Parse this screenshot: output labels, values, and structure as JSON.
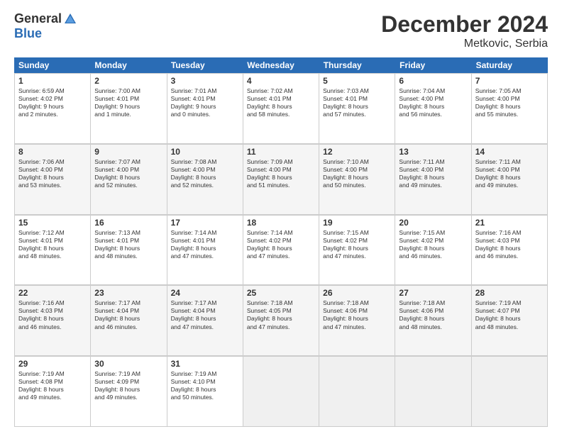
{
  "logo": {
    "general": "General",
    "blue": "Blue"
  },
  "title": "December 2024",
  "location": "Metkovic, Serbia",
  "header_days": [
    "Sunday",
    "Monday",
    "Tuesday",
    "Wednesday",
    "Thursday",
    "Friday",
    "Saturday"
  ],
  "weeks": [
    [
      {
        "day": "1",
        "lines": [
          "Sunrise: 6:59 AM",
          "Sunset: 4:02 PM",
          "Daylight: 9 hours",
          "and 2 minutes."
        ]
      },
      {
        "day": "2",
        "lines": [
          "Sunrise: 7:00 AM",
          "Sunset: 4:01 PM",
          "Daylight: 9 hours",
          "and 1 minute."
        ]
      },
      {
        "day": "3",
        "lines": [
          "Sunrise: 7:01 AM",
          "Sunset: 4:01 PM",
          "Daylight: 9 hours",
          "and 0 minutes."
        ]
      },
      {
        "day": "4",
        "lines": [
          "Sunrise: 7:02 AM",
          "Sunset: 4:01 PM",
          "Daylight: 8 hours",
          "and 58 minutes."
        ]
      },
      {
        "day": "5",
        "lines": [
          "Sunrise: 7:03 AM",
          "Sunset: 4:01 PM",
          "Daylight: 8 hours",
          "and 57 minutes."
        ]
      },
      {
        "day": "6",
        "lines": [
          "Sunrise: 7:04 AM",
          "Sunset: 4:00 PM",
          "Daylight: 8 hours",
          "and 56 minutes."
        ]
      },
      {
        "day": "7",
        "lines": [
          "Sunrise: 7:05 AM",
          "Sunset: 4:00 PM",
          "Daylight: 8 hours",
          "and 55 minutes."
        ]
      }
    ],
    [
      {
        "day": "8",
        "lines": [
          "Sunrise: 7:06 AM",
          "Sunset: 4:00 PM",
          "Daylight: 8 hours",
          "and 53 minutes."
        ]
      },
      {
        "day": "9",
        "lines": [
          "Sunrise: 7:07 AM",
          "Sunset: 4:00 PM",
          "Daylight: 8 hours",
          "and 52 minutes."
        ]
      },
      {
        "day": "10",
        "lines": [
          "Sunrise: 7:08 AM",
          "Sunset: 4:00 PM",
          "Daylight: 8 hours",
          "and 52 minutes."
        ]
      },
      {
        "day": "11",
        "lines": [
          "Sunrise: 7:09 AM",
          "Sunset: 4:00 PM",
          "Daylight: 8 hours",
          "and 51 minutes."
        ]
      },
      {
        "day": "12",
        "lines": [
          "Sunrise: 7:10 AM",
          "Sunset: 4:00 PM",
          "Daylight: 8 hours",
          "and 50 minutes."
        ]
      },
      {
        "day": "13",
        "lines": [
          "Sunrise: 7:11 AM",
          "Sunset: 4:00 PM",
          "Daylight: 8 hours",
          "and 49 minutes."
        ]
      },
      {
        "day": "14",
        "lines": [
          "Sunrise: 7:11 AM",
          "Sunset: 4:00 PM",
          "Daylight: 8 hours",
          "and 49 minutes."
        ]
      }
    ],
    [
      {
        "day": "15",
        "lines": [
          "Sunrise: 7:12 AM",
          "Sunset: 4:01 PM",
          "Daylight: 8 hours",
          "and 48 minutes."
        ]
      },
      {
        "day": "16",
        "lines": [
          "Sunrise: 7:13 AM",
          "Sunset: 4:01 PM",
          "Daylight: 8 hours",
          "and 48 minutes."
        ]
      },
      {
        "day": "17",
        "lines": [
          "Sunrise: 7:14 AM",
          "Sunset: 4:01 PM",
          "Daylight: 8 hours",
          "and 47 minutes."
        ]
      },
      {
        "day": "18",
        "lines": [
          "Sunrise: 7:14 AM",
          "Sunset: 4:02 PM",
          "Daylight: 8 hours",
          "and 47 minutes."
        ]
      },
      {
        "day": "19",
        "lines": [
          "Sunrise: 7:15 AM",
          "Sunset: 4:02 PM",
          "Daylight: 8 hours",
          "and 47 minutes."
        ]
      },
      {
        "day": "20",
        "lines": [
          "Sunrise: 7:15 AM",
          "Sunset: 4:02 PM",
          "Daylight: 8 hours",
          "and 46 minutes."
        ]
      },
      {
        "day": "21",
        "lines": [
          "Sunrise: 7:16 AM",
          "Sunset: 4:03 PM",
          "Daylight: 8 hours",
          "and 46 minutes."
        ]
      }
    ],
    [
      {
        "day": "22",
        "lines": [
          "Sunrise: 7:16 AM",
          "Sunset: 4:03 PM",
          "Daylight: 8 hours",
          "and 46 minutes."
        ]
      },
      {
        "day": "23",
        "lines": [
          "Sunrise: 7:17 AM",
          "Sunset: 4:04 PM",
          "Daylight: 8 hours",
          "and 46 minutes."
        ]
      },
      {
        "day": "24",
        "lines": [
          "Sunrise: 7:17 AM",
          "Sunset: 4:04 PM",
          "Daylight: 8 hours",
          "and 47 minutes."
        ]
      },
      {
        "day": "25",
        "lines": [
          "Sunrise: 7:18 AM",
          "Sunset: 4:05 PM",
          "Daylight: 8 hours",
          "and 47 minutes."
        ]
      },
      {
        "day": "26",
        "lines": [
          "Sunrise: 7:18 AM",
          "Sunset: 4:06 PM",
          "Daylight: 8 hours",
          "and 47 minutes."
        ]
      },
      {
        "day": "27",
        "lines": [
          "Sunrise: 7:18 AM",
          "Sunset: 4:06 PM",
          "Daylight: 8 hours",
          "and 48 minutes."
        ]
      },
      {
        "day": "28",
        "lines": [
          "Sunrise: 7:19 AM",
          "Sunset: 4:07 PM",
          "Daylight: 8 hours",
          "and 48 minutes."
        ]
      }
    ],
    [
      {
        "day": "29",
        "lines": [
          "Sunrise: 7:19 AM",
          "Sunset: 4:08 PM",
          "Daylight: 8 hours",
          "and 49 minutes."
        ]
      },
      {
        "day": "30",
        "lines": [
          "Sunrise: 7:19 AM",
          "Sunset: 4:09 PM",
          "Daylight: 8 hours",
          "and 49 minutes."
        ]
      },
      {
        "day": "31",
        "lines": [
          "Sunrise: 7:19 AM",
          "Sunset: 4:10 PM",
          "Daylight: 8 hours",
          "and 50 minutes."
        ]
      },
      {
        "day": "",
        "lines": []
      },
      {
        "day": "",
        "lines": []
      },
      {
        "day": "",
        "lines": []
      },
      {
        "day": "",
        "lines": []
      }
    ]
  ]
}
